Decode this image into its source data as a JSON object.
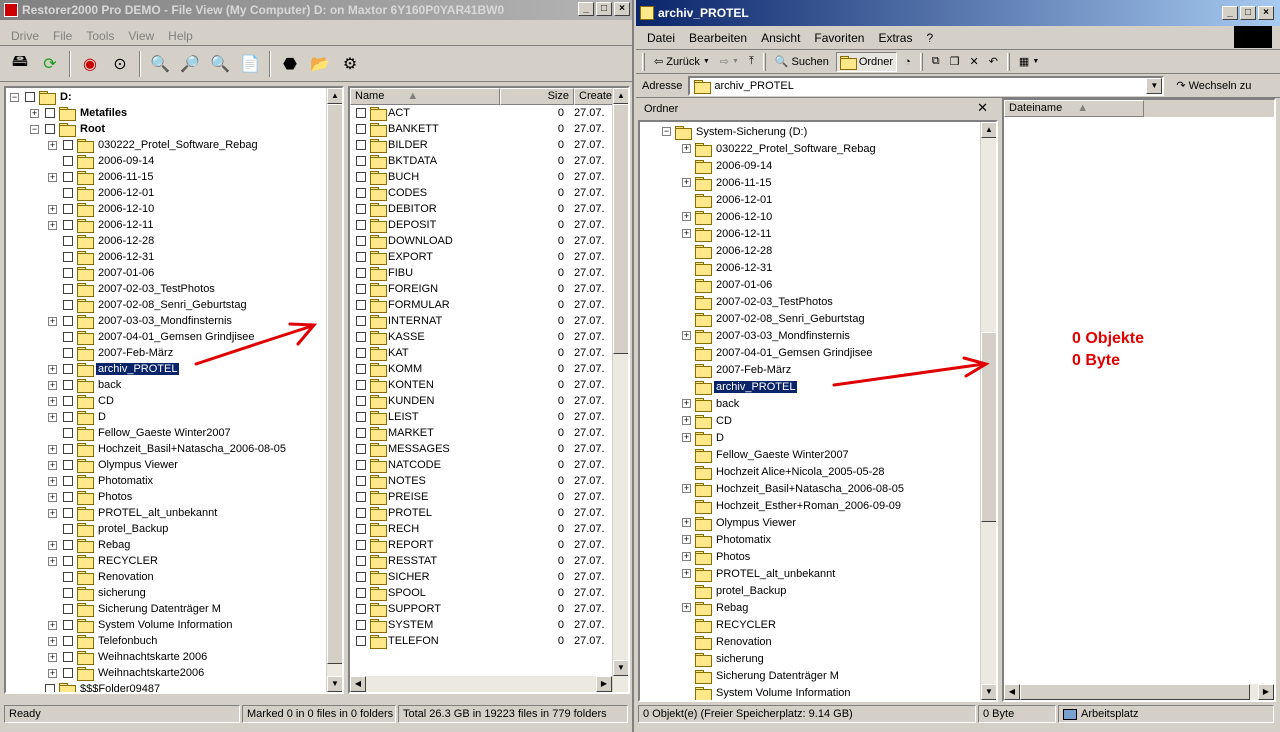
{
  "left_window": {
    "title": "Restorer2000 Pro DEMO - File View (My Computer) D: on Maxtor 6Y160P0YAR41BW0",
    "menu": [
      "Drive",
      "File",
      "Tools",
      "View",
      "Help"
    ],
    "tree": {
      "root": "D:",
      "top_items": [
        "Metafiles",
        "Root"
      ],
      "items": [
        {
          "label": "030222_Protel_Software_Rebag",
          "expandable": true
        },
        {
          "label": "2006-09-14",
          "expandable": false
        },
        {
          "label": "2006-11-15",
          "expandable": true
        },
        {
          "label": "2006-12-01",
          "expandable": false
        },
        {
          "label": "2006-12-10",
          "expandable": true
        },
        {
          "label": "2006-12-11",
          "expandable": true
        },
        {
          "label": "2006-12-28",
          "expandable": false
        },
        {
          "label": "2006-12-31",
          "expandable": false
        },
        {
          "label": "2007-01-06",
          "expandable": false
        },
        {
          "label": "2007-02-03_TestPhotos",
          "expandable": false
        },
        {
          "label": "2007-02-08_Senri_Geburtstag",
          "expandable": false
        },
        {
          "label": "2007-03-03_Mondfinsternis",
          "expandable": true
        },
        {
          "label": "2007-04-01_Gemsen Grindjisee",
          "expandable": false
        },
        {
          "label": "2007-Feb-März",
          "expandable": false
        },
        {
          "label": "archiv_PROTEL",
          "expandable": true,
          "selected": true
        },
        {
          "label": "back",
          "expandable": true
        },
        {
          "label": "CD",
          "expandable": true
        },
        {
          "label": "D",
          "expandable": true
        },
        {
          "label": "Fellow_Gaeste Winter2007",
          "expandable": false
        },
        {
          "label": "Hochzeit_Basil+Natascha_2006-08-05",
          "expandable": true
        },
        {
          "label": "Olympus Viewer",
          "expandable": true
        },
        {
          "label": "Photomatix",
          "expandable": true
        },
        {
          "label": "Photos",
          "expandable": true
        },
        {
          "label": "PROTEL_alt_unbekannt",
          "expandable": true
        },
        {
          "label": "protel_Backup",
          "expandable": false
        },
        {
          "label": "Rebag",
          "expandable": true
        },
        {
          "label": "RECYCLER",
          "expandable": true
        },
        {
          "label": "Renovation",
          "expandable": false
        },
        {
          "label": "sicherung",
          "expandable": false
        },
        {
          "label": "Sicherung Datenträger M",
          "expandable": false
        },
        {
          "label": "System Volume Information",
          "expandable": true
        },
        {
          "label": "Telefonbuch",
          "expandable": true
        },
        {
          "label": "Weihnachtskarte 2006",
          "expandable": true
        },
        {
          "label": "Weihnachtskarte2006",
          "expandable": true
        }
      ],
      "deleted_item": "$$$Folder09487"
    },
    "file_list": {
      "columns": [
        "Name",
        "Size",
        "Create"
      ],
      "rows": [
        {
          "name": "ACT",
          "size": "0",
          "date": "27.07."
        },
        {
          "name": "BANKETT",
          "size": "0",
          "date": "27.07."
        },
        {
          "name": "BILDER",
          "size": "0",
          "date": "27.07."
        },
        {
          "name": "BKTDATA",
          "size": "0",
          "date": "27.07."
        },
        {
          "name": "BUCH",
          "size": "0",
          "date": "27.07."
        },
        {
          "name": "CODES",
          "size": "0",
          "date": "27.07."
        },
        {
          "name": "DEBITOR",
          "size": "0",
          "date": "27.07."
        },
        {
          "name": "DEPOSIT",
          "size": "0",
          "date": "27.07."
        },
        {
          "name": "DOWNLOAD",
          "size": "0",
          "date": "27.07."
        },
        {
          "name": "EXPORT",
          "size": "0",
          "date": "27.07."
        },
        {
          "name": "FIBU",
          "size": "0",
          "date": "27.07."
        },
        {
          "name": "FOREIGN",
          "size": "0",
          "date": "27.07."
        },
        {
          "name": "FORMULAR",
          "size": "0",
          "date": "27.07."
        },
        {
          "name": "INTERNAT",
          "size": "0",
          "date": "27.07."
        },
        {
          "name": "KASSE",
          "size": "0",
          "date": "27.07."
        },
        {
          "name": "KAT",
          "size": "0",
          "date": "27.07."
        },
        {
          "name": "KOMM",
          "size": "0",
          "date": "27.07."
        },
        {
          "name": "KONTEN",
          "size": "0",
          "date": "27.07."
        },
        {
          "name": "KUNDEN",
          "size": "0",
          "date": "27.07."
        },
        {
          "name": "LEIST",
          "size": "0",
          "date": "27.07."
        },
        {
          "name": "MARKET",
          "size": "0",
          "date": "27.07."
        },
        {
          "name": "MESSAGES",
          "size": "0",
          "date": "27.07."
        },
        {
          "name": "NATCODE",
          "size": "0",
          "date": "27.07."
        },
        {
          "name": "NOTES",
          "size": "0",
          "date": "27.07."
        },
        {
          "name": "PREISE",
          "size": "0",
          "date": "27.07."
        },
        {
          "name": "PROTEL",
          "size": "0",
          "date": "27.07."
        },
        {
          "name": "RECH",
          "size": "0",
          "date": "27.07."
        },
        {
          "name": "REPORT",
          "size": "0",
          "date": "27.07."
        },
        {
          "name": "RESSTAT",
          "size": "0",
          "date": "27.07."
        },
        {
          "name": "SICHER",
          "size": "0",
          "date": "27.07."
        },
        {
          "name": "SPOOL",
          "size": "0",
          "date": "27.07."
        },
        {
          "name": "SUPPORT",
          "size": "0",
          "date": "27.07."
        },
        {
          "name": "SYSTEM",
          "size": "0",
          "date": "27.07."
        },
        {
          "name": "TELEFON",
          "size": "0",
          "date": "27.07."
        }
      ]
    },
    "status": {
      "ready": "Ready",
      "marked": "Marked 0 in 0 files in 0 folders",
      "total": "Total 26.3 GB in 19223 files in 779 folders"
    }
  },
  "right_window": {
    "title": "archiv_PROTEL",
    "menu": [
      "Datei",
      "Bearbeiten",
      "Ansicht",
      "Favoriten",
      "Extras",
      "?"
    ],
    "toolbar": {
      "back": "Zurück",
      "search": "Suchen",
      "folders": "Ordner"
    },
    "address_label": "Adresse",
    "address_value": "archiv_PROTEL",
    "go_label": "Wechseln zu",
    "folders_pane_title": "Ordner",
    "tree_root": "System-Sicherung (D:)",
    "tree_items": [
      {
        "label": "030222_Protel_Software_Rebag",
        "expandable": true
      },
      {
        "label": "2006-09-14",
        "expandable": false
      },
      {
        "label": "2006-11-15",
        "expandable": true
      },
      {
        "label": "2006-12-01",
        "expandable": false
      },
      {
        "label": "2006-12-10",
        "expandable": true
      },
      {
        "label": "2006-12-11",
        "expandable": true
      },
      {
        "label": "2006-12-28",
        "expandable": false
      },
      {
        "label": "2006-12-31",
        "expandable": false
      },
      {
        "label": "2007-01-06",
        "expandable": false
      },
      {
        "label": "2007-02-03_TestPhotos",
        "expandable": false
      },
      {
        "label": "2007-02-08_Senri_Geburtstag",
        "expandable": false
      },
      {
        "label": "2007-03-03_Mondfinsternis",
        "expandable": true
      },
      {
        "label": "2007-04-01_Gemsen Grindjisee",
        "expandable": false
      },
      {
        "label": "2007-Feb-März",
        "expandable": false
      },
      {
        "label": "archiv_PROTEL",
        "expandable": false,
        "selected": true
      },
      {
        "label": "back",
        "expandable": true
      },
      {
        "label": "CD",
        "expandable": true
      },
      {
        "label": "D",
        "expandable": true
      },
      {
        "label": "Fellow_Gaeste Winter2007",
        "expandable": false
      },
      {
        "label": "Hochzeit Alice+Nicola_2005-05-28",
        "expandable": false
      },
      {
        "label": "Hochzeit_Basil+Natascha_2006-08-05",
        "expandable": true
      },
      {
        "label": "Hochzeit_Esther+Roman_2006-09-09",
        "expandable": false
      },
      {
        "label": "Olympus Viewer",
        "expandable": true
      },
      {
        "label": "Photomatix",
        "expandable": true
      },
      {
        "label": "Photos",
        "expandable": true
      },
      {
        "label": "PROTEL_alt_unbekannt",
        "expandable": true
      },
      {
        "label": "protel_Backup",
        "expandable": false
      },
      {
        "label": "Rebag",
        "expandable": true
      },
      {
        "label": "RECYCLER",
        "expandable": false
      },
      {
        "label": "Renovation",
        "expandable": false
      },
      {
        "label": "sicherung",
        "expandable": false
      },
      {
        "label": "Sicherung Datenträger M",
        "expandable": false
      },
      {
        "label": "System Volume Information",
        "expandable": false
      }
    ],
    "file_column": "Dateiname",
    "status": {
      "objects": "0 Objekt(e)   (Freier Speicherplatz: 9.14 GB)",
      "bytes": "0 Byte",
      "location": "Arbeitsplatz"
    }
  },
  "annotation": {
    "line1": "0 Objekte",
    "line2": "0 Byte"
  }
}
